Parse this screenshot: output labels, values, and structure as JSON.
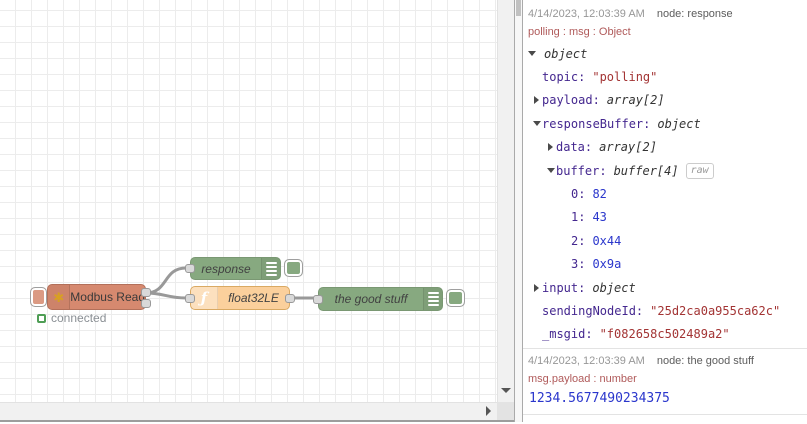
{
  "colors": {
    "modbus_node": "#d6896f",
    "debug_node_green": "#87a980",
    "function_node_orange": "#fbd09c",
    "wire": "#999999",
    "status_green": "#4f9e55",
    "key_purple": "#44278f",
    "number_blue": "#2a36cc",
    "string_red": "#a33434",
    "meta_red": "#b05a5a"
  },
  "canvas": {
    "nodes": {
      "modbus": {
        "label": "Modbus Read",
        "icon_glyph": "✱",
        "status": "connected"
      },
      "response": {
        "label": "response"
      },
      "func": {
        "label": "float32LE",
        "icon_glyph": "ƒ"
      },
      "goodstuff": {
        "label": "the good stuff"
      }
    }
  },
  "debug": {
    "messages": [
      {
        "timestamp": "4/14/2023, 12:03:39 AM",
        "node_label": "node: response",
        "meta": "polling : msg : Object",
        "rows": [
          {
            "level": 0,
            "arrow": "down",
            "key": "",
            "value": "object",
            "type": "type"
          },
          {
            "level": 1,
            "arrow": "none",
            "key": "topic:",
            "value": "\"polling\"",
            "type": "string"
          },
          {
            "level": 1,
            "arrow": "right",
            "key": "payload:",
            "value": "array[2]",
            "type": "type"
          },
          {
            "level": 1,
            "arrow": "down",
            "key": "responseBuffer:",
            "value": "object",
            "type": "type"
          },
          {
            "level": 2,
            "arrow": "right",
            "key": "data:",
            "value": "array[2]",
            "type": "type"
          },
          {
            "level": 2,
            "arrow": "down",
            "key": "buffer:",
            "value": "buffer[4]",
            "type": "type",
            "raw_button": "raw"
          },
          {
            "level": 3,
            "arrow": "none",
            "key": "0:",
            "value": "82",
            "type": "number"
          },
          {
            "level": 3,
            "arrow": "none",
            "key": "1:",
            "value": "43",
            "type": "number"
          },
          {
            "level": 3,
            "arrow": "none",
            "key": "2:",
            "value": "0x44",
            "type": "number"
          },
          {
            "level": 3,
            "arrow": "none",
            "key": "3:",
            "value": "0x9a",
            "type": "number"
          },
          {
            "level": 1,
            "arrow": "right",
            "key": "input:",
            "value": "object",
            "type": "type"
          },
          {
            "level": 1,
            "arrow": "none",
            "key": "sendingNodeId:",
            "value": "\"25d2ca0a955ca62c\"",
            "type": "string"
          },
          {
            "level": 1,
            "arrow": "none",
            "key": "_msgid:",
            "value": "\"f082658c502489a2\"",
            "type": "string"
          }
        ]
      },
      {
        "timestamp": "4/14/2023, 12:03:39 AM",
        "node_label": "node: the good stuff",
        "meta": "msg.payload : number",
        "payload": "1234.5677490234375"
      }
    ]
  }
}
